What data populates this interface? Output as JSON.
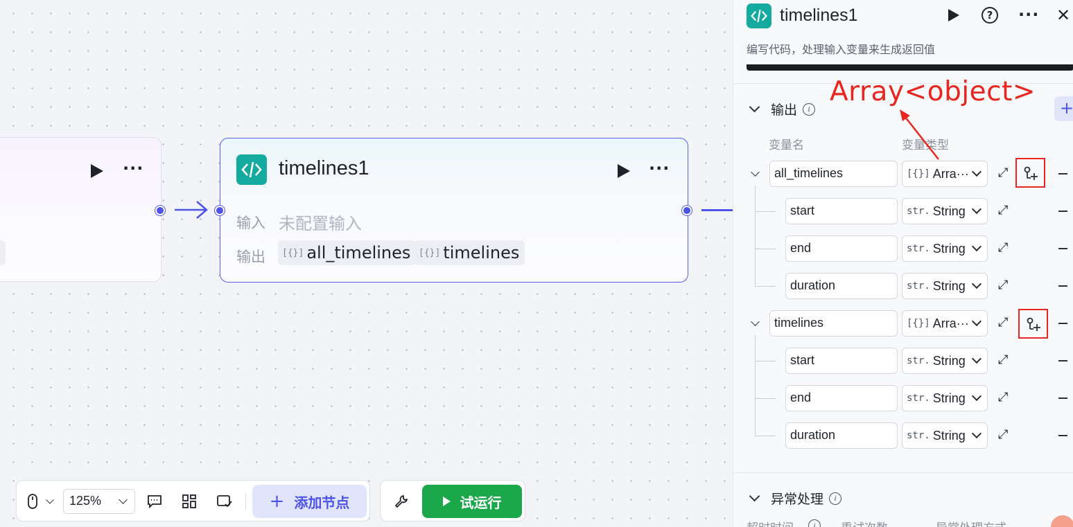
{
  "colors": {
    "accent": "#4d53e8",
    "code_tile": "#14aaa0",
    "run_green": "#1aa84a",
    "annotation_red": "#e8261f"
  },
  "canvas": {
    "main_node": {
      "title": "timelines1",
      "input_label": "输入",
      "input_value": "未配置输入",
      "output_label": "输出",
      "outputs": [
        "all_timelines",
        "timelines"
      ]
    }
  },
  "panel": {
    "title": "timelines1",
    "description": "编写代码，处理输入变量来生成返回值",
    "output_section": {
      "title": "输出",
      "col_name": "变量名",
      "col_type": "变量类型",
      "variables": [
        {
          "name": "all_timelines",
          "type_icon": "[{}]",
          "type": "Arra···",
          "children": [
            {
              "name": "start",
              "type_icon": "str.",
              "type": "String"
            },
            {
              "name": "end",
              "type_icon": "str.",
              "type": "String"
            },
            {
              "name": "duration",
              "type_icon": "str.",
              "type": "String"
            }
          ]
        },
        {
          "name": "timelines",
          "type_icon": "[{}]",
          "type": "Arra···",
          "children": [
            {
              "name": "start",
              "type_icon": "str.",
              "type": "String"
            },
            {
              "name": "end",
              "type_icon": "str.",
              "type": "String"
            },
            {
              "name": "duration",
              "type_icon": "str.",
              "type": "String"
            }
          ]
        }
      ]
    },
    "exception_section": {
      "title": "异常处理",
      "col_timeout": "超时时间",
      "col_retry": "重试次数",
      "col_mode": "异常处理方式"
    }
  },
  "annotation": "Array<object>",
  "toolbar": {
    "zoom": "125%",
    "add_node": "添加节点",
    "test_run": "试运行"
  }
}
